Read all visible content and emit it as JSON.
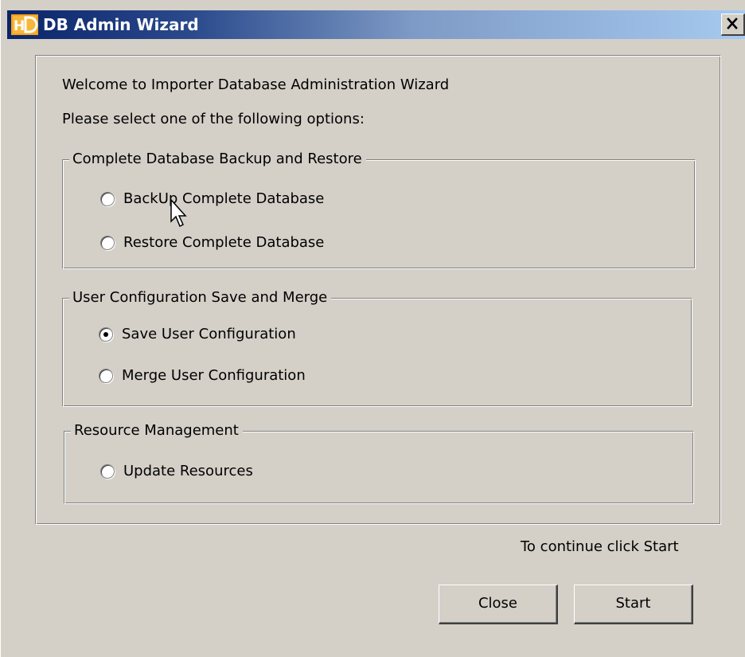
{
  "window": {
    "title": "DB Admin Wizard",
    "app_icon": "hd-logo-icon",
    "close_icon": "close-icon",
    "titlebar_colors": [
      "#0a246a",
      "#a6caf0"
    ],
    "face_color": "#d4d0c8"
  },
  "intro": {
    "welcome": "Welcome to Importer Database Administration Wizard",
    "instruction": "Please select one of the following options:"
  },
  "groups": [
    {
      "legend": "Complete Database Backup and Restore",
      "options": [
        {
          "label": "BackUp Complete Database",
          "checked": false
        },
        {
          "label": "Restore Complete Database",
          "checked": false
        }
      ]
    },
    {
      "legend": "User Configuration Save and Merge",
      "options": [
        {
          "label": "Save User Configuration",
          "checked": true
        },
        {
          "label": "Merge User Configuration",
          "checked": false
        }
      ]
    },
    {
      "legend": "Resource Management",
      "options": [
        {
          "label": "Update Resources",
          "checked": false
        }
      ]
    }
  ],
  "footer": {
    "hint": "To continue click Start",
    "close_label": "Close",
    "start_label": "Start"
  },
  "cursor": "arrow-cursor-icon"
}
